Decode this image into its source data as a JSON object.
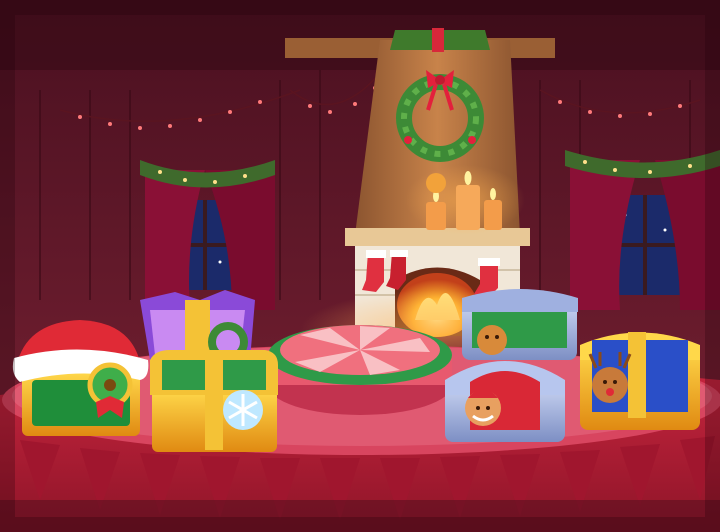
{
  "scene": {
    "theme": "christmas-chest-room",
    "colors": {
      "wall": "#6e1a2c",
      "wall_dark": "#3f0c1a",
      "curtain": "#8a1036",
      "platform_top": "#d8455f",
      "platform_side": "#b8203a",
      "chimney": "#b06f3c",
      "fire": "#ffb833"
    }
  },
  "chests": [
    {
      "id": "santa-chest",
      "icon": "santa-hat-chest-icon"
    },
    {
      "id": "purple-chest",
      "icon": "purple-wreath-chest-icon"
    },
    {
      "id": "snowflake-chest",
      "icon": "snowflake-chest-icon"
    },
    {
      "id": "center-pedestal",
      "icon": "candy-pedestal-icon"
    },
    {
      "id": "gingerbread-chest",
      "icon": "gingerbread-chest-icon"
    },
    {
      "id": "blue-santa-chest",
      "icon": "santa-cookie-chest-icon"
    },
    {
      "id": "reindeer-chest",
      "icon": "reindeer-chest-icon"
    }
  ]
}
